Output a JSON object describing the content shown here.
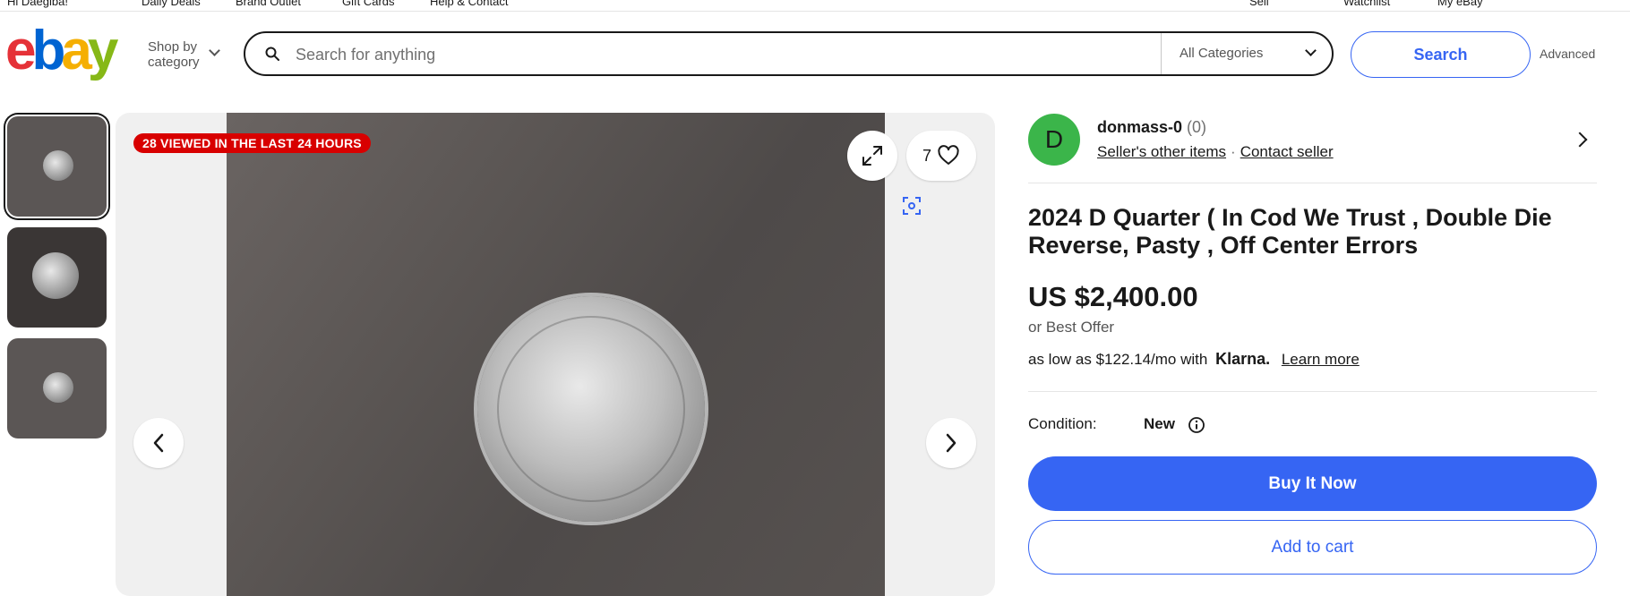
{
  "topbar": {
    "items": [
      "Hi Daegiba!",
      "Daily Deals",
      "Brand Outlet",
      "Gift Cards",
      "Help & Contact"
    ],
    "right_items": [
      "Sell",
      "Watchlist",
      "My eBay"
    ]
  },
  "header": {
    "logo": {
      "e": "e",
      "b": "b",
      "a": "a",
      "y": "y"
    },
    "shop_by_line1": "Shop by",
    "shop_by_line2": "category",
    "search_placeholder": "Search for anything",
    "category_select": "All Categories",
    "search_button": "Search",
    "advanced_link": "Advanced"
  },
  "gallery": {
    "badge": "28 VIEWED IN THE LAST 24 HOURS",
    "watch_count": "7",
    "thumbnail_count": 3
  },
  "seller": {
    "initial": "D",
    "name": "donmass-0",
    "feedback": "(0)",
    "other_items": "Seller's other items",
    "contact": "Contact seller"
  },
  "item": {
    "title": "2024 D Quarter ( In Cod We Trust , Double Die Reverse, Pasty , Off Center Errors",
    "price": "US $2,400.00",
    "best_offer": "or Best Offer",
    "klarna_text": "as low as $122.14/mo with",
    "klarna_brand": "Klarna.",
    "learn_more": "Learn more",
    "condition_label": "Condition:",
    "condition_value": "New",
    "buy_now": "Buy It Now",
    "add_to_cart": "Add to cart"
  },
  "colors": {
    "accent": "#3665f3",
    "badge": "#d80000",
    "avatar": "#3bb54a"
  }
}
